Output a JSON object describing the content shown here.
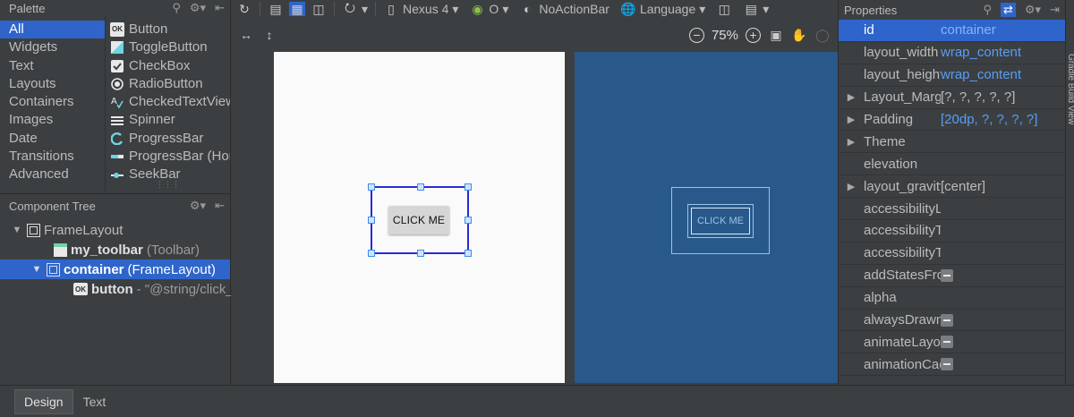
{
  "palette": {
    "title": "Palette",
    "categories": [
      {
        "label": "All",
        "selected": true
      },
      {
        "label": "Widgets"
      },
      {
        "label": "Text"
      },
      {
        "label": "Layouts"
      },
      {
        "label": "Containers"
      },
      {
        "label": "Images"
      },
      {
        "label": "Date"
      },
      {
        "label": "Transitions"
      },
      {
        "label": "Advanced"
      }
    ],
    "items": [
      {
        "label": "Button",
        "icon": "button-icon"
      },
      {
        "label": "ToggleButton",
        "icon": "toggle-button-icon"
      },
      {
        "label": "CheckBox",
        "icon": "checkbox-icon"
      },
      {
        "label": "RadioButton",
        "icon": "radio-button-icon"
      },
      {
        "label": "CheckedTextView",
        "icon": "checked-text-view-icon"
      },
      {
        "label": "Spinner",
        "icon": "spinner-icon"
      },
      {
        "label": "ProgressBar",
        "icon": "progress-bar-icon"
      },
      {
        "label": "ProgressBar (Horizontal)",
        "icon": "horizontal-progress-bar-icon"
      },
      {
        "label": "SeekBar",
        "icon": "seekbar-icon"
      }
    ]
  },
  "tree": {
    "title": "Component Tree",
    "nodes": [
      {
        "label": "FrameLayout",
        "detail": ""
      },
      {
        "label": "my_toolbar",
        "detail": "(Toolbar)"
      },
      {
        "label": "container",
        "detail": "(FrameLayout)"
      },
      {
        "label": "button",
        "detail": "- \"@string/click_me\""
      }
    ]
  },
  "toolbar": {
    "device": "Nexus 4",
    "api": "O",
    "theme": "NoActionBar",
    "language": "Language",
    "zoom": "75%"
  },
  "canvas": {
    "button_text": "CLICK ME",
    "blueprint_button_text": "CLICK ME"
  },
  "properties": {
    "title": "Properties",
    "rows": [
      {
        "name": "id",
        "value": "container"
      },
      {
        "name": "layout_width",
        "value": "wrap_content"
      },
      {
        "name": "layout_height",
        "value": "wrap_content"
      },
      {
        "name": "Layout_Margin",
        "value": "[?, ?, ?, ?, ?]"
      },
      {
        "name": "Padding",
        "value": "[20dp, ?, ?, ?, ?]"
      },
      {
        "name": "Theme",
        "value": ""
      },
      {
        "name": "elevation",
        "value": ""
      },
      {
        "name": "layout_gravity",
        "value": "[center]"
      },
      {
        "name": "accessibilityLiveRegion",
        "value": ""
      },
      {
        "name": "accessibilityTraversalAfter",
        "value": ""
      },
      {
        "name": "accessibilityTraversalBefore",
        "value": ""
      },
      {
        "name": "addStatesFromChildren",
        "value": ""
      },
      {
        "name": "alpha",
        "value": ""
      },
      {
        "name": "alwaysDrawnWithCache",
        "value": ""
      },
      {
        "name": "animateLayoutChanges",
        "value": ""
      },
      {
        "name": "animationCache",
        "value": ""
      }
    ],
    "side_tab": "Gradle Build View"
  },
  "bottom_tabs": [
    {
      "label": "Design",
      "selected": true
    },
    {
      "label": "Text"
    }
  ],
  "colors": {
    "panel_bg": "#3c3f41",
    "selection": "#2f65ca",
    "blueprint": "#28598a",
    "value_blue": "#589df6",
    "selection_border": "#2a2ad6"
  }
}
